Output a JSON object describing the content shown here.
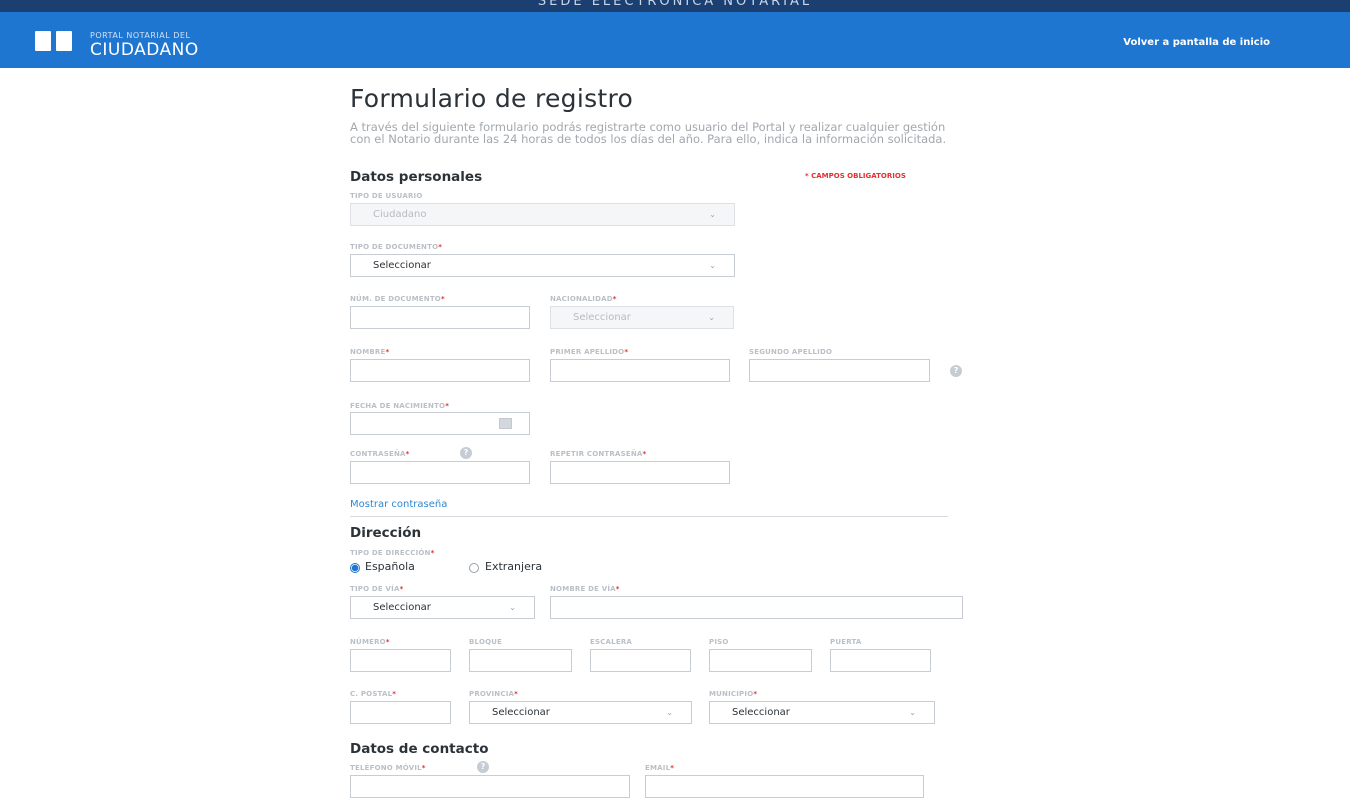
{
  "banner": {
    "text": "SEDE ELECTRÓNICA NOTARIAL"
  },
  "header": {
    "logo_small": "PORTAL NOTARIAL DEL",
    "logo_big": "CIUDADANO",
    "back_link": "Volver a pantalla de inicio"
  },
  "page": {
    "title": "Formulario de registro",
    "intro": "A través del siguiente formulario podrás registrarte como usuario del Portal y realizar cualquier gestión con el Notario durante las 24 horas de todos los días del año. Para ello, indica la información solicitada.",
    "required_note": "* CAMPOS OBLIGATORIOS"
  },
  "personal": {
    "section_title": "Datos personales",
    "user_type": {
      "label": "TIPO DE USUARIO",
      "value": "Ciudadano"
    },
    "doc_type": {
      "label": "TIPO DE DOCUMENTO",
      "value": "Seleccionar"
    },
    "doc_number": {
      "label": "NÚM. DE DOCUMENTO"
    },
    "nationality": {
      "label": "NACIONALIDAD",
      "value": "Seleccionar"
    },
    "name": {
      "label": "NOMBRE"
    },
    "surname1": {
      "label": "PRIMER APELLIDO"
    },
    "surname2": {
      "label": "SEGUNDO APELLIDO"
    },
    "birth_date": {
      "label": "FECHA DE NACIMIENTO"
    },
    "password": {
      "label": "CONTRASEÑA"
    },
    "password_repeat": {
      "label": "REPETIR CONTRASEÑA"
    },
    "show_password": "Mostrar contraseña"
  },
  "address": {
    "section_title": "Dirección",
    "address_type": {
      "label": "TIPO DE DIRECCIÓN",
      "options": [
        "Española",
        "Extranjera"
      ],
      "selected": "Española"
    },
    "street_type": {
      "label": "TIPO DE VÍA",
      "value": "Seleccionar"
    },
    "street_name": {
      "label": "NOMBRE DE VÍA"
    },
    "number": {
      "label": "NÚMERO"
    },
    "block": {
      "label": "BLOQUE"
    },
    "stair": {
      "label": "ESCALERA"
    },
    "floor": {
      "label": "PISO"
    },
    "door": {
      "label": "PUERTA"
    },
    "postal_code": {
      "label": "C. POSTAL"
    },
    "province": {
      "label": "PROVINCIA",
      "value": "Seleccionar"
    },
    "municipality": {
      "label": "MUNICIPIO",
      "value": "Seleccionar"
    }
  },
  "contact": {
    "section_title": "Datos de contacto",
    "mobile": {
      "label": "TELÉFONO MÓVIL"
    },
    "email": {
      "label": "EMAIL"
    }
  },
  "symbols": {
    "required_mark": "*",
    "caret": "⌄",
    "help": "?"
  },
  "colors": {
    "header_blue": "#1f76d0",
    "banner_navy": "#1c3f72",
    "required_red": "#e03131",
    "link_blue": "#2f86d4"
  }
}
